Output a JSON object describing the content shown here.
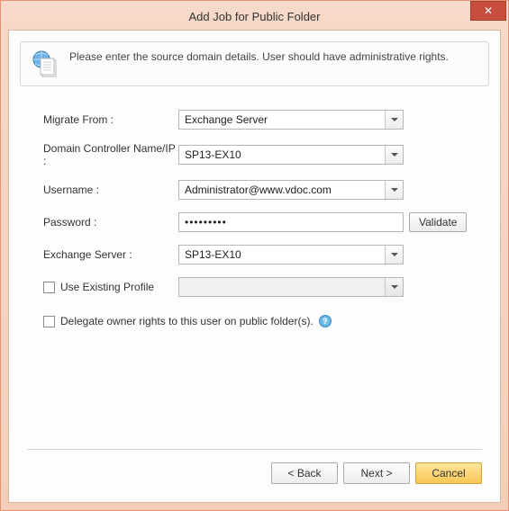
{
  "window": {
    "title": "Add Job for Public Folder",
    "close_glyph": "✕"
  },
  "intro": {
    "text": "Please enter the source domain details. User should have administrative rights."
  },
  "form": {
    "migrate_from": {
      "label": "Migrate From :",
      "value": "Exchange Server"
    },
    "domain_controller": {
      "label": "Domain Controller Name/IP :",
      "value": "SP13-EX10"
    },
    "username": {
      "label": "Username :",
      "value": "Administrator@www.vdoc.com"
    },
    "password": {
      "label": "Password :",
      "value": "•••••••••",
      "validate_label": "Validate"
    },
    "exchange_server": {
      "label": "Exchange Server :",
      "value": "SP13-EX10"
    },
    "use_profile": {
      "label": "Use Existing Profile",
      "value": ""
    },
    "delegate": {
      "label": "Delegate owner rights to this user on public folder(s).",
      "help_glyph": "?"
    }
  },
  "footer": {
    "back": "< Back",
    "next": "Next >",
    "cancel": "Cancel"
  }
}
